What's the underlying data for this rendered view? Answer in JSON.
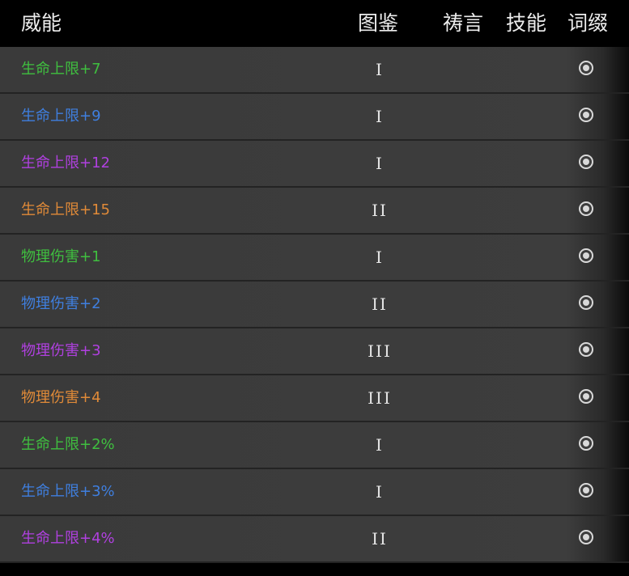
{
  "colors": {
    "green": "#3fbf3f",
    "blue": "#3f7fdf",
    "purple": "#b040e0",
    "orange": "#e08a38"
  },
  "header": {
    "name": "威能",
    "codex": "图鉴",
    "prayer": "祷言",
    "skill": "技能",
    "affix": "词缀"
  },
  "rows": [
    {
      "name": "生命上限+7",
      "tier": "I",
      "color": "green",
      "selected": true
    },
    {
      "name": "生命上限+9",
      "tier": "I",
      "color": "blue",
      "selected": true
    },
    {
      "name": "生命上限+12",
      "tier": "I",
      "color": "purple",
      "selected": true
    },
    {
      "name": "生命上限+15",
      "tier": "II",
      "color": "orange",
      "selected": true
    },
    {
      "name": "物理伤害+1",
      "tier": "I",
      "color": "green",
      "selected": true
    },
    {
      "name": "物理伤害+2",
      "tier": "II",
      "color": "blue",
      "selected": true
    },
    {
      "name": "物理伤害+3",
      "tier": "III",
      "color": "purple",
      "selected": true
    },
    {
      "name": "物理伤害+4",
      "tier": "III",
      "color": "orange",
      "selected": true
    },
    {
      "name": "生命上限+2%",
      "tier": "I",
      "color": "green",
      "selected": true
    },
    {
      "name": "生命上限+3%",
      "tier": "I",
      "color": "blue",
      "selected": true
    },
    {
      "name": "生命上限+4%",
      "tier": "II",
      "color": "purple",
      "selected": true
    }
  ]
}
